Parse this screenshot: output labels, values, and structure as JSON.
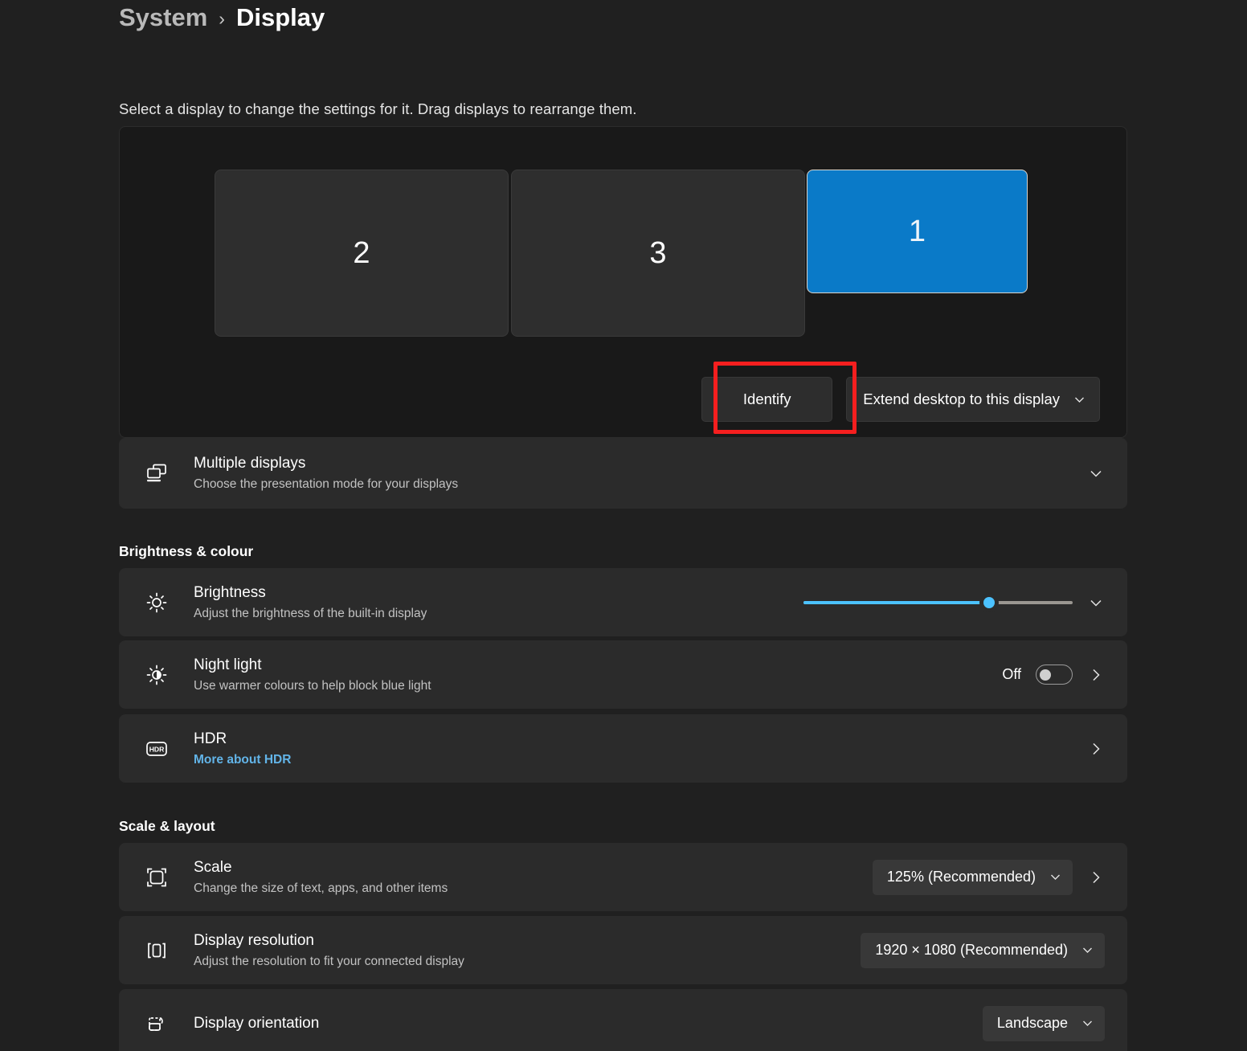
{
  "breadcrumb": {
    "parent": "System",
    "separator": "›",
    "current": "Display"
  },
  "intro": "Select a display to change the settings for it. Drag displays to rearrange them.",
  "arrangement": {
    "monitors": [
      {
        "label": "2",
        "selected": false
      },
      {
        "label": "3",
        "selected": false
      },
      {
        "label": "1",
        "selected": true
      }
    ],
    "identify_label": "Identify",
    "mode_dropdown": "Extend desktop to this display",
    "highlight_color": "#f61f1f"
  },
  "multiple_displays": {
    "title": "Multiple displays",
    "subtitle": "Choose the presentation mode for your displays",
    "icon": "multiple-displays-icon"
  },
  "brightness_colour": {
    "heading": "Brightness & colour",
    "brightness": {
      "title": "Brightness",
      "subtitle": "Adjust the brightness of the built-in display",
      "value_percent": 69,
      "accent": "#4cc2ff",
      "icon": "brightness-sun-icon"
    },
    "night_light": {
      "title": "Night light",
      "subtitle": "Use warmer colours to help block blue light",
      "state": "Off",
      "icon": "night-light-icon"
    },
    "hdr": {
      "title": "HDR",
      "link": "More about HDR",
      "link_color": "#62b4e8",
      "icon": "hdr-icon"
    }
  },
  "scale_layout": {
    "heading": "Scale & layout",
    "scale": {
      "title": "Scale",
      "subtitle": "Change the size of text, apps, and other items",
      "value": "125% (Recommended)",
      "icon": "scale-icon"
    },
    "resolution": {
      "title": "Display resolution",
      "subtitle": "Adjust the resolution to fit your connected display",
      "value": "1920 × 1080 (Recommended)",
      "icon": "resolution-icon"
    },
    "orientation": {
      "title": "Display orientation",
      "value": "Landscape",
      "icon": "orientation-icon"
    }
  }
}
